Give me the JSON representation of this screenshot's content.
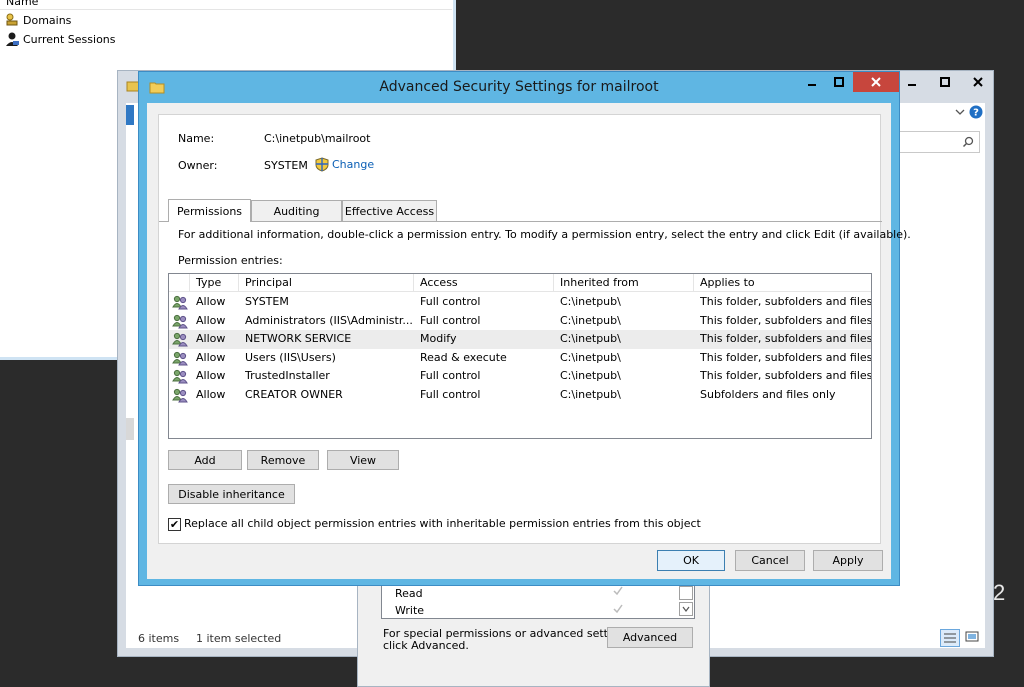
{
  "mmc": {
    "column_header": "Name",
    "tree": [
      "Domains",
      "Current Sessions"
    ]
  },
  "explorer": {
    "status_items": "6 items",
    "status_selected": "1 item selected",
    "partial_char": "2"
  },
  "props": {
    "perms": [
      {
        "name": "Read"
      },
      {
        "name": "Write"
      }
    ],
    "special_text_line1": "For special permissions or advanced settings,",
    "special_text_line2": "click Advanced.",
    "advanced_button": "Advanced"
  },
  "dialog": {
    "title": "Advanced Security Settings for mailroot",
    "name_label": "Name:",
    "name_value": "C:\\inetpub\\mailroot",
    "owner_label": "Owner:",
    "owner_value": "SYSTEM",
    "change_link": "Change",
    "tabs": [
      "Permissions",
      "Auditing",
      "Effective Access"
    ],
    "info_text": "For additional information, double-click a permission entry. To modify a permission entry, select the entry and click Edit (if available).",
    "entries_label": "Permission entries:",
    "columns": [
      "Type",
      "Principal",
      "Access",
      "Inherited from",
      "Applies to"
    ],
    "rows": [
      {
        "type": "Allow",
        "principal": "SYSTEM",
        "access": "Full control",
        "inherited": "C:\\inetpub\\",
        "applies": "This folder, subfolders and files"
      },
      {
        "type": "Allow",
        "principal": "Administrators (IIS\\Administr...",
        "access": "Full control",
        "inherited": "C:\\inetpub\\",
        "applies": "This folder, subfolders and files"
      },
      {
        "type": "Allow",
        "principal": "NETWORK SERVICE",
        "access": "Modify",
        "inherited": "C:\\inetpub\\",
        "applies": "This folder, subfolders and files"
      },
      {
        "type": "Allow",
        "principal": "Users (IIS\\Users)",
        "access": "Read & execute",
        "inherited": "C:\\inetpub\\",
        "applies": "This folder, subfolders and files"
      },
      {
        "type": "Allow",
        "principal": "TrustedInstaller",
        "access": "Full control",
        "inherited": "C:\\inetpub\\",
        "applies": "This folder, subfolders and files"
      },
      {
        "type": "Allow",
        "principal": "CREATOR OWNER",
        "access": "Full control",
        "inherited": "C:\\inetpub\\",
        "applies": "Subfolders and files only"
      }
    ],
    "selected_row": 2,
    "buttons": {
      "add": "Add",
      "remove": "Remove",
      "view": "View"
    },
    "disable_inheritance": "Disable inheritance",
    "replace_checkbox": "Replace all child object permission entries with inheritable permission entries from this object",
    "replace_checked": true,
    "ok": "OK",
    "cancel": "Cancel",
    "apply": "Apply"
  },
  "colors": {
    "titlebar": "#5fb6e3",
    "close": "#c7463d",
    "link": "#0b5fb5"
  }
}
